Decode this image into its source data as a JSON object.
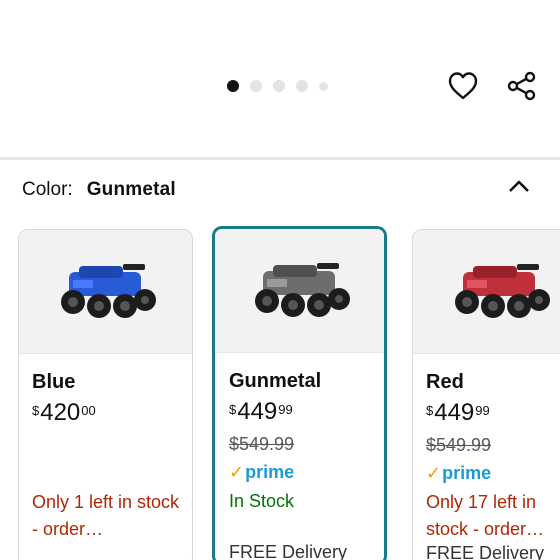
{
  "gallery": {
    "dots_count": 5,
    "active_dot": 0
  },
  "color_selector": {
    "label": "Color:",
    "value": "Gunmetal"
  },
  "variants": [
    {
      "name": "Blue",
      "price_symbol": "$",
      "price_whole": "420",
      "price_fraction": "00",
      "stock": "Only 1 left in stock - order…",
      "vehicle_color": "#2a5bd7"
    },
    {
      "name": "Gunmetal",
      "price_symbol": "$",
      "price_whole": "449",
      "price_fraction": "99",
      "list_price": "$549.99",
      "prime": "prime",
      "stock": "In Stock",
      "delivery": "FREE Delivery",
      "vehicle_color": "#6d6d6d"
    },
    {
      "name": "Red",
      "price_symbol": "$",
      "price_whole": "449",
      "price_fraction": "99",
      "list_price": "$549.99",
      "prime": "prime",
      "stock": "Only 17 left in stock - order…",
      "delivery": "FREE Delivery",
      "vehicle_color": "#c0303a"
    }
  ],
  "colors": {
    "selected_border": "#1a7a8a",
    "low_stock": "#b12704",
    "in_stock": "#007600",
    "prime_blue": "#1b9ad6",
    "prime_check": "#ff9900"
  },
  "icons": {
    "favorite": "heart-icon",
    "share": "share-icon",
    "collapse": "chevron-up-icon"
  }
}
